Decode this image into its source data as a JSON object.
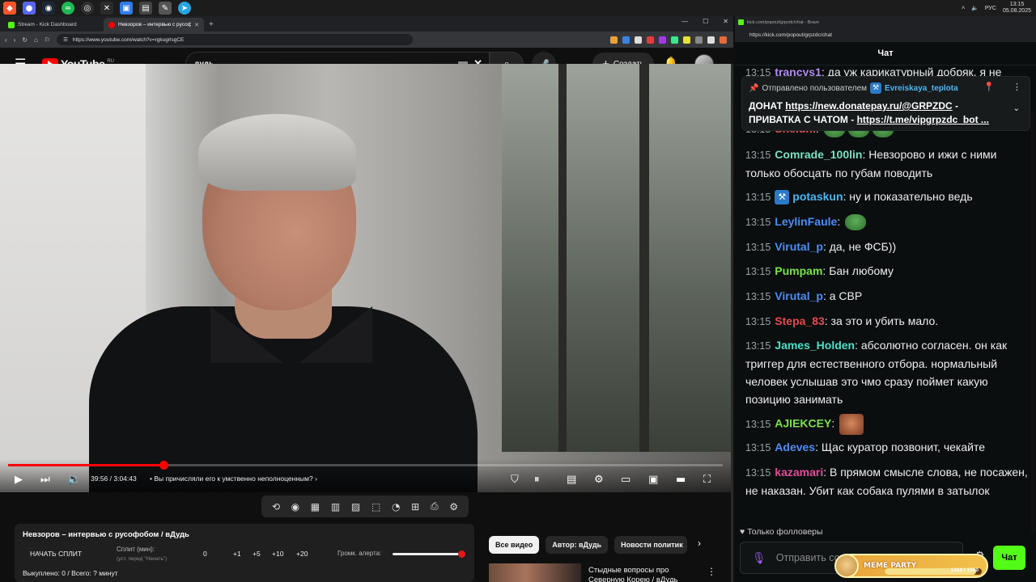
{
  "taskbar": {
    "apps": [
      "brave",
      "discord",
      "steam",
      "spotify",
      "obs",
      "kick",
      "app-blue",
      "terminal",
      "app-edit",
      "telegram"
    ],
    "lang": "РУС",
    "time": "13:15",
    "date": "05.08.2025"
  },
  "browser_left": {
    "tabs": [
      {
        "label": "Stream - Kick Dashboard",
        "active": false
      },
      {
        "label": "Невзоров – интервью с русофо...",
        "active": true
      }
    ],
    "url": "https://www.youtube.com/watch?v=rgkugrlsgCE"
  },
  "youtube": {
    "logo_text": "YouTube",
    "region": "RU",
    "search_value": "дудь",
    "create_label": "Создать",
    "player": {
      "time": "39:56 / 3:04:43",
      "chapter": "• Вы причисляли его к умственно неполноценным?",
      "progress": 0.217,
      "chapter_arrow": "›"
    },
    "chips": [
      "Все видео",
      "Автор: вДудь",
      "Новости политик"
    ],
    "recommendation": {
      "title": "Стыдные вопросы про Северную Корею / вДудь"
    }
  },
  "split_panel": {
    "title": "Невзоров – интервью с русофобом / вДудь",
    "start_label": "НАЧАТЬ СПЛИТ",
    "split_label": "Сплит (мин):",
    "split_hint": "(уст. перед \"Начать\")",
    "values": [
      "0",
      "+1",
      "+5",
      "+10",
      "+20"
    ],
    "alert_label": "Громк. алерта:",
    "alert_volume": 1.0,
    "bought": "Выкуплено: 0 / Всего: ? минут"
  },
  "browser_right": {
    "title": "kick.com/popout/grpzdc/chat - Brave",
    "url": "https://kick.com/popout/grpzdc/chat"
  },
  "chat": {
    "header": "Чат",
    "pinned": {
      "by_prefix": "Отправлено пользователем",
      "by_user": "Evreiskaya_teplota",
      "line1_pre": "ДОНАТ ",
      "line1_link": "https://new.donatepay.ru/@GRPZDC",
      "line1_post": " -",
      "line2_pre": "ПРИВАТКА С ЧАТОМ - ",
      "line2_link": "https://t.me/vipgrpzdc_bot ..."
    },
    "messages": [
      {
        "time": "13:15",
        "user": "trancys1",
        "color": "#b48cf0",
        "text": "да уж карикатурный добряк, я не"
      },
      {
        "time": "13:15",
        "user": "Sneiuni",
        "color": "#e05454",
        "text": ""
      },
      {
        "time": "13:15",
        "user": "Comrade_100lin",
        "color": "#7ce0c3",
        "text": "Невзорово и ижи с ними только обосцать по губам поводить"
      },
      {
        "time": "13:15",
        "user": "potaskun",
        "color": "#4db6f5",
        "text": "ну и показательно ведь"
      },
      {
        "time": "13:15",
        "user": "LeylinFaule",
        "color": "#4d8cf5",
        "text": ""
      },
      {
        "time": "13:15",
        "user": "Virutal_p",
        "color": "#4d8cf5",
        "text": "да, не ФСБ))"
      },
      {
        "time": "13:15",
        "user": "Pumpam",
        "color": "#7ce04d",
        "text": "Бан любому"
      },
      {
        "time": "13:15",
        "user": "Virutal_p",
        "color": "#4d8cf5",
        "text": "а СВР"
      },
      {
        "time": "13:15",
        "user": "Stepa_83",
        "color": "#e04d4d",
        "text": "за это и убить мало."
      },
      {
        "time": "13:15",
        "user": "James_Holden",
        "color": "#4de0c8",
        "text": "абсолютно согласен. он как триггер для естественного отбора. нормальный человек услышав это чмо сразу поймет какую позицию занимать"
      },
      {
        "time": "13:15",
        "user": "AJIEKCEY",
        "color": "#7ce04d",
        "text": ""
      },
      {
        "time": "13:15",
        "user": "Adeves",
        "color": "#4d8cf5",
        "text": "Щас куратор позвонит, чекайте"
      },
      {
        "time": "13:15",
        "user": "kazamari",
        "color": "#e04d9a",
        "text": "В прямом смысле слова, не посажен, не наказан. Убит как собака пулями в затылок"
      }
    ],
    "followers_label": "Только фолловеры",
    "input_placeholder": "Отправить со...",
    "send_label": "Чат",
    "meme_party": {
      "label": "MEME PARTY",
      "count": "1410 / 1500",
      "fraction": 0.94
    }
  },
  "colors": {
    "yt_red": "#ff0000",
    "kick_green": "#53fc18"
  }
}
